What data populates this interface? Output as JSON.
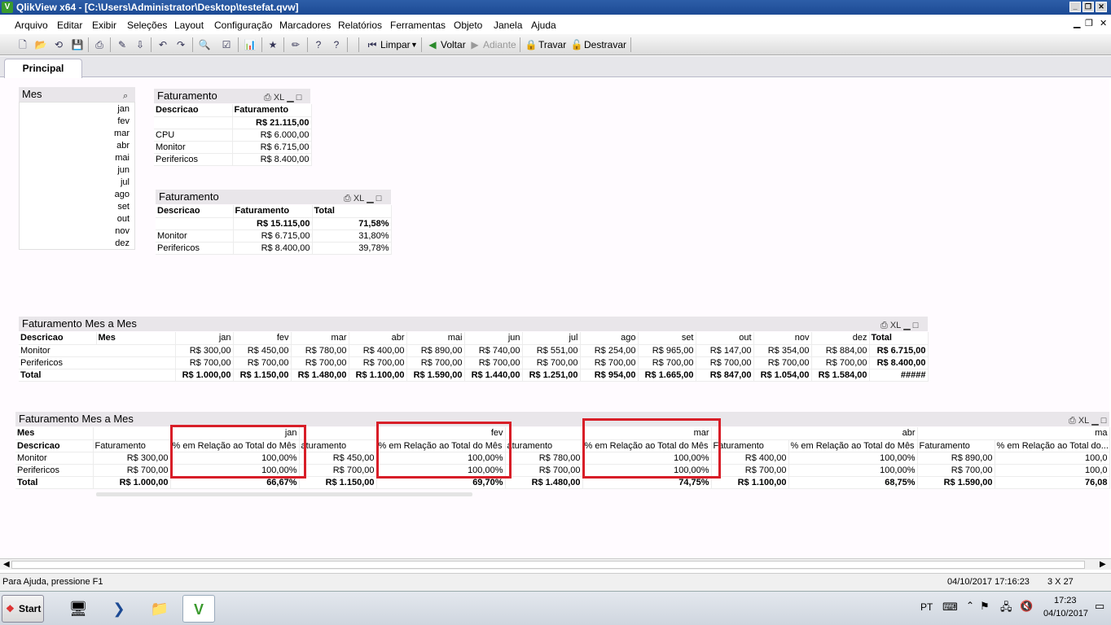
{
  "window": {
    "title": "QlikView x64 - [C:\\Users\\Administrator\\Desktop\\testefat.qvw]",
    "icon": "V"
  },
  "menu": [
    "Arquivo",
    "Editar",
    "Exibir",
    "Seleções",
    "Layout",
    "Configuração",
    "Marcadores",
    "Relatórios",
    "Ferramentas",
    "Objeto",
    "Janela",
    "Ajuda"
  ],
  "toolbar": {
    "clear_label": "Limpar",
    "back_label": "Voltar",
    "forward_label": "Adiante",
    "lock_label": "Travar",
    "unlock_label": "Destravar"
  },
  "tabs": [
    {
      "label": "Principal",
      "active": true
    }
  ],
  "listbox_mes": {
    "title": "Mes",
    "items": [
      "jan",
      "fev",
      "mar",
      "abr",
      "mai",
      "jun",
      "jul",
      "ago",
      "set",
      "out",
      "nov",
      "dez"
    ]
  },
  "caption_icons": {
    "print": "⎙",
    "xl": "XL",
    "minimize": "▁",
    "maximize": "□"
  },
  "table1": {
    "title": "Faturamento",
    "headers": [
      "Descricao",
      "Faturamento"
    ],
    "total": [
      "",
      "R$ 21.115,00"
    ],
    "rows": [
      [
        "CPU",
        "R$ 6.000,00"
      ],
      [
        "Monitor",
        "R$ 6.715,00"
      ],
      [
        "Perifericos",
        "R$ 8.400,00"
      ]
    ]
  },
  "table2": {
    "title": "Faturamento",
    "headers": [
      "Descricao",
      "Faturamento",
      "Total"
    ],
    "total": [
      "",
      "R$ 15.115,00",
      "71,58%"
    ],
    "rows": [
      [
        "Monitor",
        "R$ 6.715,00",
        "31,80%"
      ],
      [
        "Perifericos",
        "R$ 8.400,00",
        "39,78%"
      ]
    ]
  },
  "pivot1": {
    "title": "Faturamento Mes a Mes",
    "dims": [
      "Descricao",
      "Mes"
    ],
    "months": [
      "jan",
      "fev",
      "mar",
      "abr",
      "mai",
      "jun",
      "jul",
      "ago",
      "set",
      "out",
      "nov",
      "dez"
    ],
    "total_label": "Total",
    "rows": [
      {
        "label": "Monitor",
        "values": [
          "R$ 300,00",
          "R$ 450,00",
          "R$ 780,00",
          "R$ 400,00",
          "R$ 890,00",
          "R$ 740,00",
          "R$ 551,00",
          "R$ 254,00",
          "R$ 965,00",
          "R$ 147,00",
          "R$ 354,00",
          "R$ 884,00"
        ],
        "total": "R$ 6.715,00"
      },
      {
        "label": "Perifericos",
        "values": [
          "R$ 700,00",
          "R$ 700,00",
          "R$ 700,00",
          "R$ 700,00",
          "R$ 700,00",
          "R$ 700,00",
          "R$ 700,00",
          "R$ 700,00",
          "R$ 700,00",
          "R$ 700,00",
          "R$ 700,00",
          "R$ 700,00"
        ],
        "total": "R$ 8.400,00"
      },
      {
        "label": "Total",
        "values": [
          "R$ 1.000,00",
          "R$ 1.150,00",
          "R$ 1.480,00",
          "R$ 1.100,00",
          "R$ 1.590,00",
          "R$ 1.440,00",
          "R$ 1.251,00",
          "R$ 954,00",
          "R$ 1.665,00",
          "R$ 847,00",
          "R$ 1.054,00",
          "R$ 1.584,00"
        ],
        "total": "#####"
      }
    ]
  },
  "pivot2": {
    "title": "Faturamento Mes a Mes",
    "dim_mes": "Mes",
    "dim_desc": "Descricao",
    "months": [
      "jan",
      "fev",
      "mar",
      "abr",
      "ma"
    ],
    "measures": [
      "Faturamento",
      "% em Relação ao Total do Mês",
      "aturamento",
      "% em Relação ao Total do Mês",
      "aturamento",
      "% em Relação ao Total do Mês",
      "Faturamento",
      "% em Relação ao Total do Mês",
      "Faturamento",
      "% em Relação ao Total do..."
    ],
    "rows": [
      {
        "label": "Monitor",
        "values": [
          "R$ 300,00",
          "100,00%",
          "R$ 450,00",
          "100,00%",
          "R$ 780,00",
          "100,00%",
          "R$ 400,00",
          "100,00%",
          "R$ 890,00",
          "100,0"
        ]
      },
      {
        "label": "Perifericos",
        "values": [
          "R$ 700,00",
          "100,00%",
          "R$ 700,00",
          "100,00%",
          "R$ 700,00",
          "100,00%",
          "R$ 700,00",
          "100,00%",
          "R$ 700,00",
          "100,0"
        ]
      },
      {
        "label": "Total",
        "values": [
          "R$ 1.000,00",
          "66,67%",
          "R$ 1.150,00",
          "69,70%",
          "R$ 1.480,00",
          "74,75%",
          "R$ 1.100,00",
          "68,75%",
          "R$ 1.590,00",
          "76,08"
        ]
      }
    ]
  },
  "statusbar": {
    "help": "Para Ajuda, pressione F1",
    "datetime": "04/10/2017 17:16:23",
    "dims": "3 X 27"
  },
  "taskbar": {
    "start": "Start",
    "lang": "PT",
    "time": "17:23",
    "date": "04/10/2017"
  }
}
